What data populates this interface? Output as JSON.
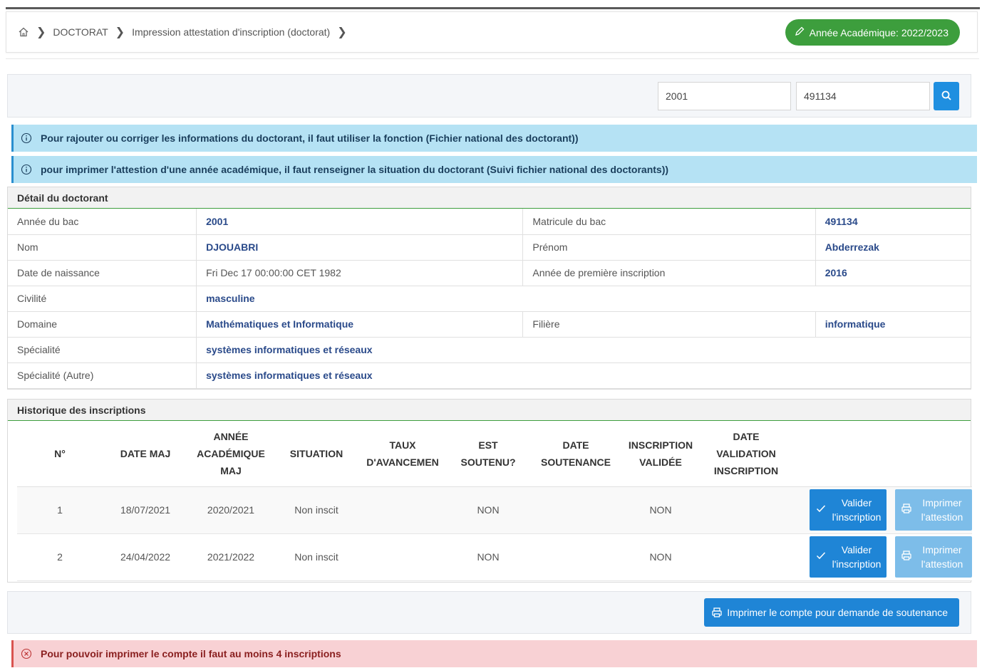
{
  "breadcrumb": {
    "items": [
      "DOCTORAT",
      "Impression attestation d'inscription (doctorat)"
    ],
    "home_icon": "home-icon",
    "separator_icon": "chevron-right-icon"
  },
  "academic_year": {
    "label": "Année Académique: 2022/2023",
    "icon": "pencil-icon",
    "color": "#3d9e3d"
  },
  "search": {
    "bac_year": "2001",
    "bac_matricule": "491134",
    "icon": "search-icon"
  },
  "alerts": {
    "info1": "Pour rajouter ou corriger les informations du doctorant, il faut utiliser la fonction (Fichier national des doctorant))",
    "info2": "pour imprimer l'attestion d'une année académique, il faut renseigner la situation du doctorant (Suivi fichier national des doctorants))",
    "danger": "Pour pouvoir imprimer le compte il faut au moins 4 inscriptions"
  },
  "detail": {
    "title": "Détail du doctorant",
    "annee_bac_label": "Année du bac",
    "annee_bac": "2001",
    "matricule_label": "Matricule du bac",
    "matricule": "491134",
    "nom_label": "Nom",
    "nom": "DJOUABRI",
    "prenom_label": "Prénom",
    "prenom": "Abderrezak",
    "naissance_label": "Date de naissance",
    "naissance": "Fri Dec 17 00:00:00 CET 1982",
    "premiere_label": "Année de première inscription",
    "premiere": "2016",
    "civilite_label": "Civilité",
    "civilite": "masculine",
    "domaine_label": "Domaine",
    "domaine": "Mathématiques et Informatique",
    "filiere_label": "Filière",
    "filiere": "informatique",
    "specialite_label": "Spécialité",
    "specialite": "systèmes informatiques et réseaux",
    "specialite_autre_label": "Spécialité (Autre)",
    "specialite_autre": "systèmes informatiques et réseaux"
  },
  "history": {
    "title": "Historique des inscriptions",
    "headers": {
      "num": "N°",
      "date_maj": "DATE MAJ",
      "annee_l1": "ANNÉE",
      "annee_l2": "ACADÉMIQUE",
      "annee_l3": "MAJ",
      "situation": "SITUATION",
      "taux_l1": "TAUX",
      "taux_l2": "D'AVANCEMEN",
      "soutenu_l1": "EST",
      "soutenu_l2": "SOUTENU?",
      "date_sout_l1": "DATE",
      "date_sout_l2": "SOUTENANCE",
      "insc_l1": "INSCRIPTION",
      "insc_l2": "VALIDÉE",
      "dv_l1": "DATE",
      "dv_l2": "VALIDATION",
      "dv_l3": "INSCRIPTION"
    },
    "rows": [
      {
        "num": "1",
        "date_maj": "18/07/2021",
        "annee": "2020/2021",
        "situation": "Non inscit",
        "taux": "",
        "soutenu": "NON",
        "date_sout": "",
        "validee": "NON",
        "date_valid": ""
      },
      {
        "num": "2",
        "date_maj": "24/04/2022",
        "annee": "2021/2022",
        "situation": "Non inscit",
        "taux": "",
        "soutenu": "NON",
        "date_sout": "",
        "validee": "NON",
        "date_valid": ""
      }
    ],
    "btn_valider_l1": "Valider",
    "btn_valider_l2": "l'inscription",
    "btn_imprimer_l1": "Imprimer",
    "btn_imprimer_l2": "l'attestion"
  },
  "footer": {
    "print_label": "Imprimer le compte pour demande de soutenance",
    "icon": "print-icon"
  }
}
